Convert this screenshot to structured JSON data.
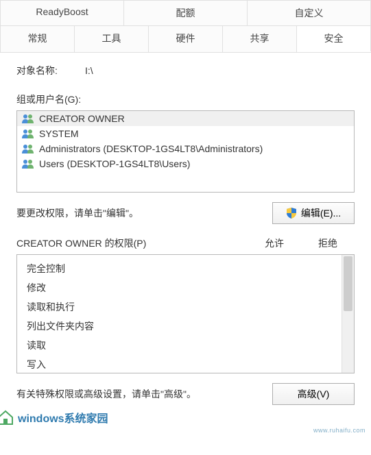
{
  "tabs_row1": [
    {
      "label": "ReadyBoost"
    },
    {
      "label": "配额"
    },
    {
      "label": "自定义"
    }
  ],
  "tabs_row2": [
    {
      "label": "常规"
    },
    {
      "label": "工具"
    },
    {
      "label": "硬件"
    },
    {
      "label": "共享"
    },
    {
      "label": "安全",
      "active": true
    }
  ],
  "object_name_label": "对象名称:",
  "object_name_value": "I:\\",
  "groups_label": "组或用户名(G):",
  "principals": [
    {
      "name": "CREATOR OWNER",
      "selected": true
    },
    {
      "name": "SYSTEM"
    },
    {
      "name": "Administrators (DESKTOP-1GS4LT8\\Administrators)"
    },
    {
      "name": "Users (DESKTOP-1GS4LT8\\Users)"
    }
  ],
  "edit_hint": "要更改权限，请单击\"编辑\"。",
  "edit_button": "编辑(E)...",
  "perm_header_name": "CREATOR OWNER 的权限(P)",
  "perm_header_allow": "允许",
  "perm_header_deny": "拒绝",
  "permissions": [
    {
      "name": "完全控制"
    },
    {
      "name": "修改"
    },
    {
      "name": "读取和执行"
    },
    {
      "name": "列出文件夹内容"
    },
    {
      "name": "读取"
    },
    {
      "name": "写入"
    }
  ],
  "advanced_hint": "有关特殊权限或高级设置，请单击\"高级\"。",
  "advanced_button": "高级(V)",
  "watermark_main": "windows系统家园",
  "watermark_sub": "www.ruhaifu.com"
}
